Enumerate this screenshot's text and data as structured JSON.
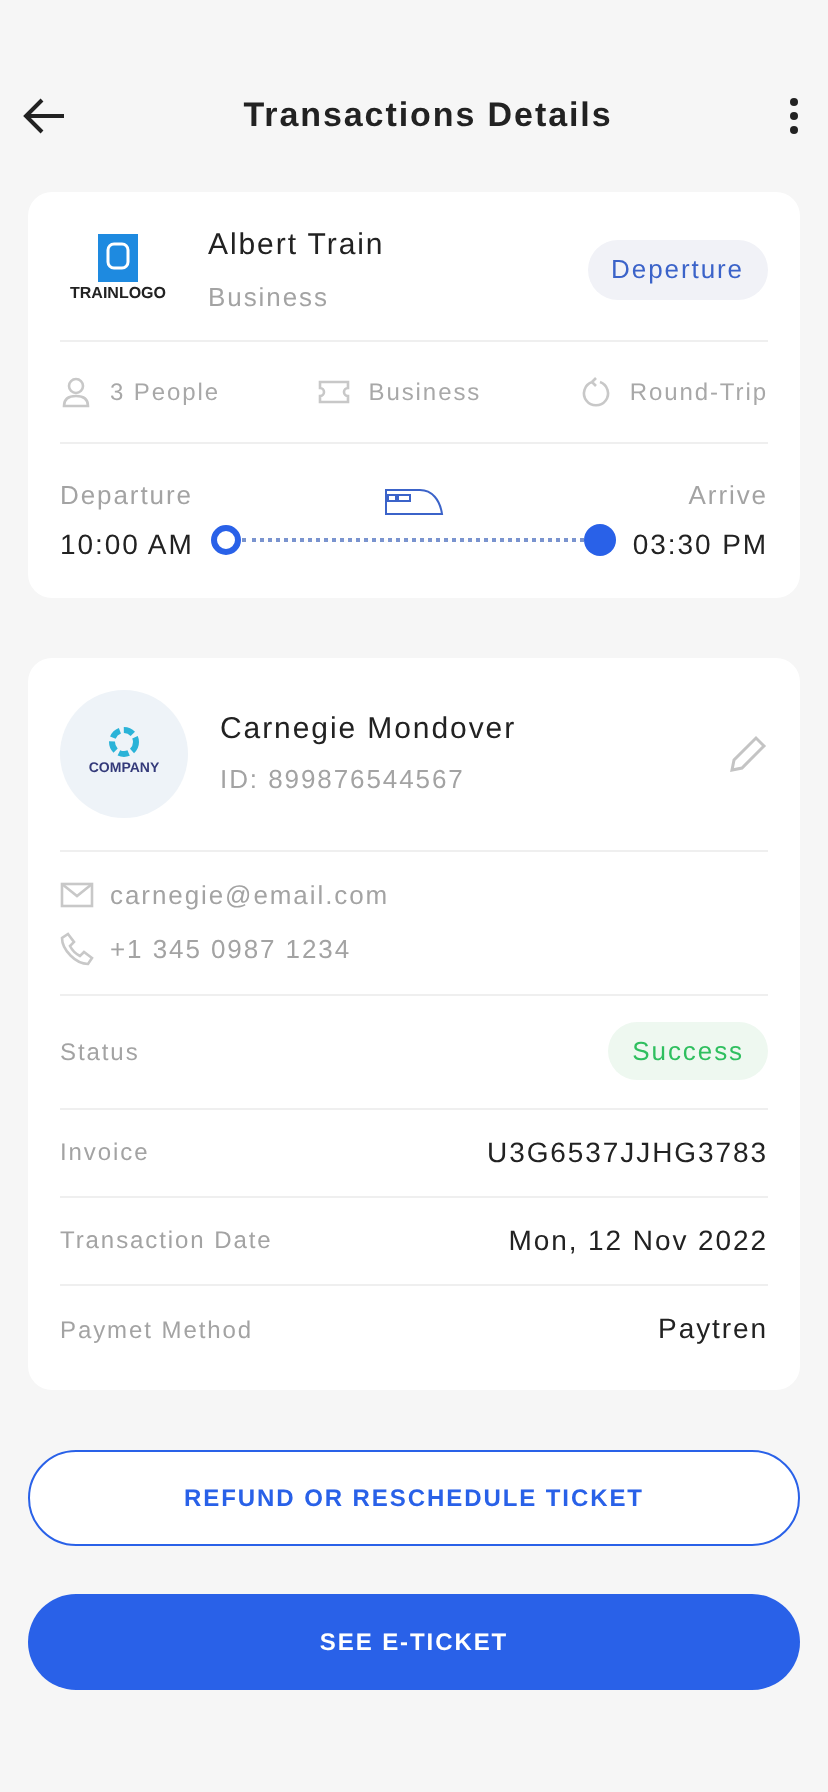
{
  "header": {
    "title": "Transactions Details"
  },
  "trip": {
    "logo_text": "TRAINLOGO",
    "name": "Albert Train",
    "class": "Business",
    "badge": "Deperture",
    "features": [
      {
        "kind": "people",
        "label": "3 People"
      },
      {
        "kind": "ticket",
        "label": "Business"
      },
      {
        "kind": "roundtrip",
        "label": "Round-Trip"
      }
    ],
    "departure": {
      "label": "Departure",
      "time": "10:00 AM"
    },
    "arrive": {
      "label": "Arrive",
      "time": "03:30 PM"
    }
  },
  "customer": {
    "logo_text": "COMPANY",
    "name": "Carnegie Mondover",
    "id": "ID: 899876544567",
    "contacts": [
      {
        "kind": "email",
        "text": "carnegie@email.com"
      },
      {
        "kind": "phone",
        "text": "+1 345 0987 1234"
      }
    ],
    "details": [
      {
        "kind": "status",
        "label": "Status",
        "value": "Success"
      },
      {
        "kind": "text",
        "label": "Invoice",
        "value": "U3G6537JJHG3783"
      },
      {
        "kind": "text",
        "label": "Transaction Date",
        "value": "Mon, 12 Nov 2022"
      },
      {
        "kind": "text",
        "label": "Paymet Method",
        "value": "Paytren"
      }
    ]
  },
  "buttons": [
    {
      "kind": "outline",
      "label": "REFUND OR RESCHEDULE TICKET"
    },
    {
      "kind": "primary",
      "label": "SEE E-TICKET"
    }
  ]
}
